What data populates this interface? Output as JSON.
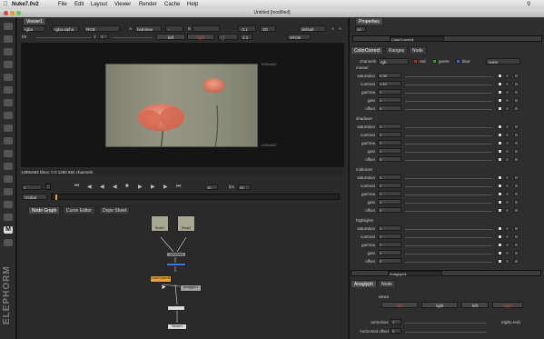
{
  "menubar": {
    "items": [
      "Nuke7.0v2",
      "File",
      "Edit",
      "Layout",
      "Viewer",
      "Render",
      "Cache",
      "Help"
    ]
  },
  "titlebar": {
    "title": "Untitled [modified]"
  },
  "viewer": {
    "tab": "Viewer1",
    "channels": "rgba",
    "channels2": "rgba.alpha",
    "channels3": "RGB",
    "input_a": "A",
    "input_a_value": "bokView",
    "input_b": "B",
    "zoom": "-3.1",
    "mode2d": "2D",
    "lut": "default",
    "exposure_label": "f/8",
    "gain": "1",
    "gamma": "Y",
    "gamma_val": "1",
    "left_label": "left",
    "right_label": "right",
    "colorspace": "sRGB",
    "proxy": "1:1",
    "format_label": "1280x682",
    "bbox_label": "1280x682",
    "status": "1280x682  bbox: 0 0 1280 682 channels:",
    "frame": "1",
    "frame_end": "10",
    "fps_label": "fps",
    "fps": "24",
    "global_label": "Global"
  },
  "lower_tabs": [
    "Node Graph",
    "Curve Editor",
    "Dope Sheet"
  ],
  "nodes": {
    "read1": "Read1",
    "read2": "Read2",
    "join": "JoinViews",
    "colorcorrect": "ColorCorrect1",
    "viewer": "Viewer1",
    "anaglyph": "Anaglyph1",
    "oneview": "OneView"
  },
  "properties": {
    "title": "Properties",
    "counter": "10",
    "node_name": "ColorCorrect1",
    "tabs": [
      "ColorCorrect",
      "Ranges",
      "Node"
    ],
    "channels_label": "channels",
    "channels_value": "rgb",
    "red": "red",
    "green": "green",
    "blue": "blue",
    "none": "none",
    "sections": [
      {
        "name": "master",
        "rows": [
          {
            "label": "saturation",
            "value": "0.35"
          },
          {
            "label": "contrast",
            "value": "1.42"
          },
          {
            "label": "gamma",
            "value": "1"
          },
          {
            "label": "gain",
            "value": "1"
          },
          {
            "label": "offset",
            "value": "0"
          }
        ]
      },
      {
        "name": "shadows",
        "rows": [
          {
            "label": "saturation",
            "value": "1"
          },
          {
            "label": "contrast",
            "value": "1"
          },
          {
            "label": "gamma",
            "value": "1"
          },
          {
            "label": "gain",
            "value": "1"
          },
          {
            "label": "offset",
            "value": "0"
          }
        ]
      },
      {
        "name": "midtones",
        "rows": [
          {
            "label": "saturation",
            "value": "1"
          },
          {
            "label": "contrast",
            "value": "1"
          },
          {
            "label": "gamma",
            "value": "1"
          },
          {
            "label": "gain",
            "value": "1"
          },
          {
            "label": "offset",
            "value": "0"
          }
        ]
      },
      {
        "name": "highlights",
        "rows": [
          {
            "label": "saturation",
            "value": "1"
          },
          {
            "label": "contrast",
            "value": "1"
          },
          {
            "label": "gamma",
            "value": "1"
          },
          {
            "label": "gain",
            "value": "1"
          },
          {
            "label": "offset",
            "value": "0"
          }
        ]
      }
    ],
    "anaglyph": {
      "name": "Anaglyph1",
      "tabs": [
        "Anaglyph",
        "Node"
      ],
      "views_label": "views",
      "views": [
        "left",
        "right",
        "left",
        "right"
      ],
      "amtcolour_label": "amtcolour",
      "amtcolour_value": "1",
      "right_red": "(right=red)",
      "hoffset_label": "horizontal offset",
      "hoffset_value": "0"
    }
  },
  "toolbar_logo": "ELEPHORM",
  "colors": {
    "accent": "#e8a23a",
    "red": "#cc2222",
    "green": "#22aa22",
    "blue": "#3366dd"
  }
}
